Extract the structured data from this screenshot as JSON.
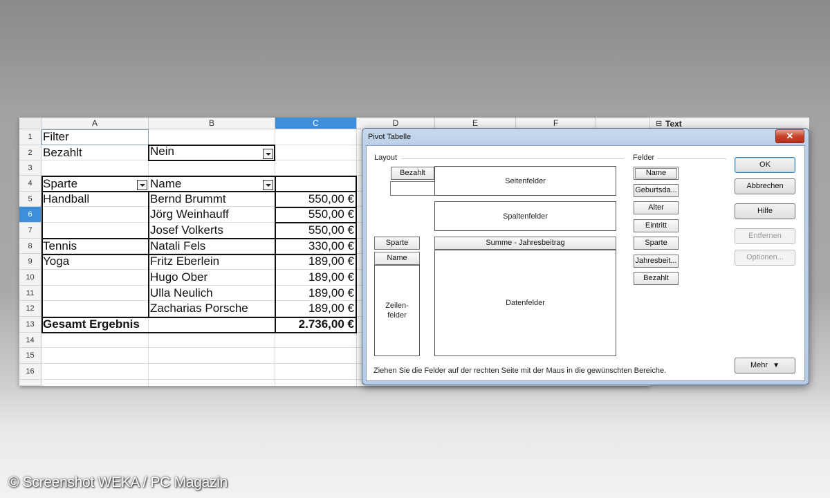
{
  "spreadsheet": {
    "columns": [
      "A",
      "B",
      "C",
      "D",
      "E",
      "F"
    ],
    "rows": [
      "1",
      "2",
      "3",
      "4",
      "5",
      "6",
      "7",
      "8",
      "9",
      "10",
      "11",
      "12",
      "13",
      "14",
      "15",
      "16"
    ],
    "selected_column": "C",
    "selected_row": "6",
    "side_panel_label": "Text",
    "cells": {
      "a1": "Filter",
      "a2": "Bezahlt",
      "b2": "Nein",
      "a4": "Sparte",
      "b4": "Name",
      "a5": "Handball",
      "b5": "Bernd Brummt",
      "c5": "550,00 €",
      "b6": "Jörg Weinhauff",
      "c6": "550,00 €",
      "b7": "Josef Volkerts",
      "c7": "550,00 €",
      "a8": "Tennis",
      "b8": "Natali Fels",
      "c8": "330,00 €",
      "a9": "Yoga",
      "b9": "Fritz Eberlein",
      "c9": "189,00 €",
      "b10": "Hugo Ober",
      "c10": "189,00 €",
      "b11": "Ulla Neulich",
      "c11": "189,00 €",
      "b12": "Zacharias Porsche",
      "c12": "189,00 €",
      "a13": "Gesamt Ergebnis",
      "c13": "2.736,00 €"
    }
  },
  "dialog": {
    "title": "Pivot Tabelle",
    "close_label": "✕",
    "layout_label": "Layout",
    "felder_label": "Felder",
    "page_field_button": "Bezahlt",
    "seitenfelder": "Seitenfelder",
    "spaltenfelder": "Spaltenfelder",
    "row_field_1": "Sparte",
    "row_field_2": "Name",
    "zeilenfelder": "Zeilen-\nfelder",
    "data_field_button": "Summe - Jahresbeitrag",
    "datenfelder": "Datenfelder",
    "fields": [
      "Name",
      "Geburtsda...",
      "Alter",
      "Eintritt",
      "Sparte",
      "Jahresbeit...",
      "Bezahlt"
    ],
    "buttons": {
      "ok": "OK",
      "cancel": "Abbrechen",
      "help": "Hilfe",
      "remove": "Entfernen",
      "options": "Optionen...",
      "more": "Mehr"
    },
    "hint": "Ziehen Sie die Felder auf der rechten Seite mit der Maus in die gewünschten Bereiche."
  },
  "watermark": "© Screenshot WEKA / PC Magazin"
}
